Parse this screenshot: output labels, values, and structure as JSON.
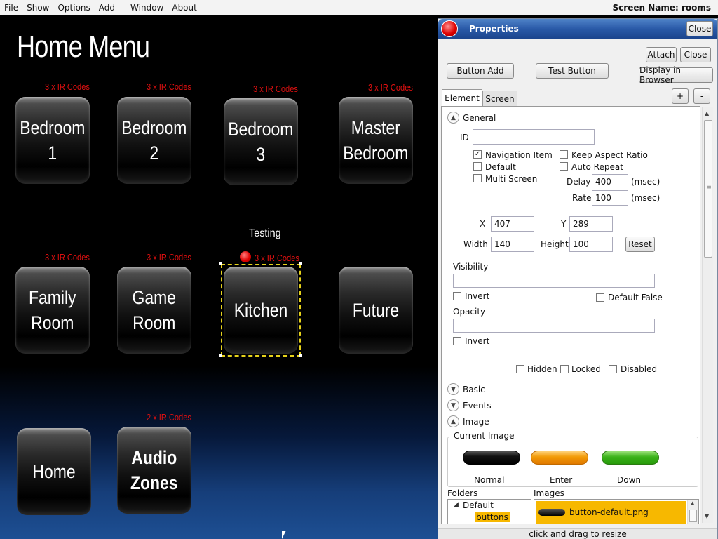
{
  "menubar": {
    "items": [
      "File",
      "Show",
      "Options",
      "Add",
      "Window",
      "About"
    ],
    "screen_name": "Screen Name: rooms"
  },
  "canvas": {
    "title": "Home Menu",
    "testing_label": "Testing",
    "buttons": [
      {
        "label": "Bedroom 1",
        "ir": "3 x IR Codes"
      },
      {
        "label": "Bedroom 2",
        "ir": "3 x IR Codes"
      },
      {
        "label": "Bedroom 3",
        "ir": "3 x IR Codes"
      },
      {
        "label": "Master\nBedroom",
        "ir": "3 x IR Codes"
      },
      {
        "label": "Family\nRoom",
        "ir": "3 x IR Codes"
      },
      {
        "label": "Game\nRoom",
        "ir": "3 x IR Codes"
      },
      {
        "label": "Kitchen",
        "ir": "3 x IR Codes"
      },
      {
        "label": "Future",
        "ir": ""
      },
      {
        "label": "Home",
        "ir": ""
      },
      {
        "label": "Audio\nZones",
        "ir": "2 x IR Codes"
      }
    ]
  },
  "panel": {
    "title": "Properties",
    "close_title": "Close",
    "attach": "Attach",
    "close": "Close",
    "button_add": "Button Add",
    "test_button": "Test Button",
    "display_in_browser": "Display in Browser",
    "tabs": [
      "Element",
      "Screen"
    ],
    "plus": "+",
    "minus": "-",
    "general": {
      "heading": "General",
      "id_label": "ID",
      "id_value": "",
      "navigation_item": "Navigation Item",
      "navigation_item_checked": true,
      "default": "Default",
      "multi_screen": "Multi Screen",
      "keep_aspect_ratio": "Keep Aspect Ratio",
      "auto_repeat": "Auto Repeat",
      "delay_label": "Delay",
      "delay_value": "400",
      "rate_label": "Rate",
      "rate_value": "100",
      "msec": "(msec)",
      "x_label": "X",
      "x_value": "407",
      "y_label": "Y",
      "y_value": "289",
      "width_label": "Width",
      "width_value": "140",
      "height_label": "Height",
      "height_value": "100",
      "reset": "Reset",
      "visibility": "Visibility",
      "invert": "Invert",
      "default_false": "Default False",
      "opacity": "Opacity",
      "hidden": "Hidden",
      "locked": "Locked",
      "disabled": "Disabled"
    },
    "sections": [
      "Basic",
      "Events",
      "Image"
    ],
    "image": {
      "current_image": "Current Image",
      "normal": "Normal",
      "enter": "Enter",
      "down": "Down",
      "folders_label": "Folders",
      "images_label": "Images",
      "folder_root": "Default",
      "folder_child": "buttons",
      "image_file": "button-default.png"
    },
    "status": "click and drag to resize"
  }
}
